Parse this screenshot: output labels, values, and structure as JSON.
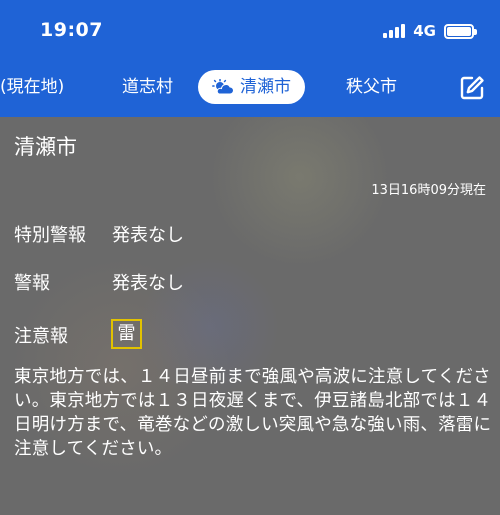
{
  "status": {
    "time": "19:07",
    "network": "4G"
  },
  "tabs": [
    {
      "label": "(現在地)"
    },
    {
      "label": "道志村"
    },
    {
      "label": "清瀬市",
      "active": true,
      "icon": "partly-cloudy-icon"
    },
    {
      "label": "秩父市"
    }
  ],
  "edit_icon": "edit-icon",
  "colors": {
    "header": "#1f63d6",
    "badge_border": "#e2c200",
    "background": "#6a6a6a"
  },
  "main": {
    "city": "清瀬市",
    "timestamp": "13日16時09分現在",
    "rows": [
      {
        "label": "特別警報",
        "value": "発表なし"
      },
      {
        "label": "警報",
        "value": "発表なし"
      },
      {
        "label": "注意報",
        "value": "雷"
      }
    ],
    "message": "東京地方では、１４日昼前まで強風や高波に注意してください。東京地方では１３日夜遅くまで、伊豆諸島北部では１４日明け方まで、竜巻などの激しい突風や急な強い雨、落雷に注意してください。"
  }
}
